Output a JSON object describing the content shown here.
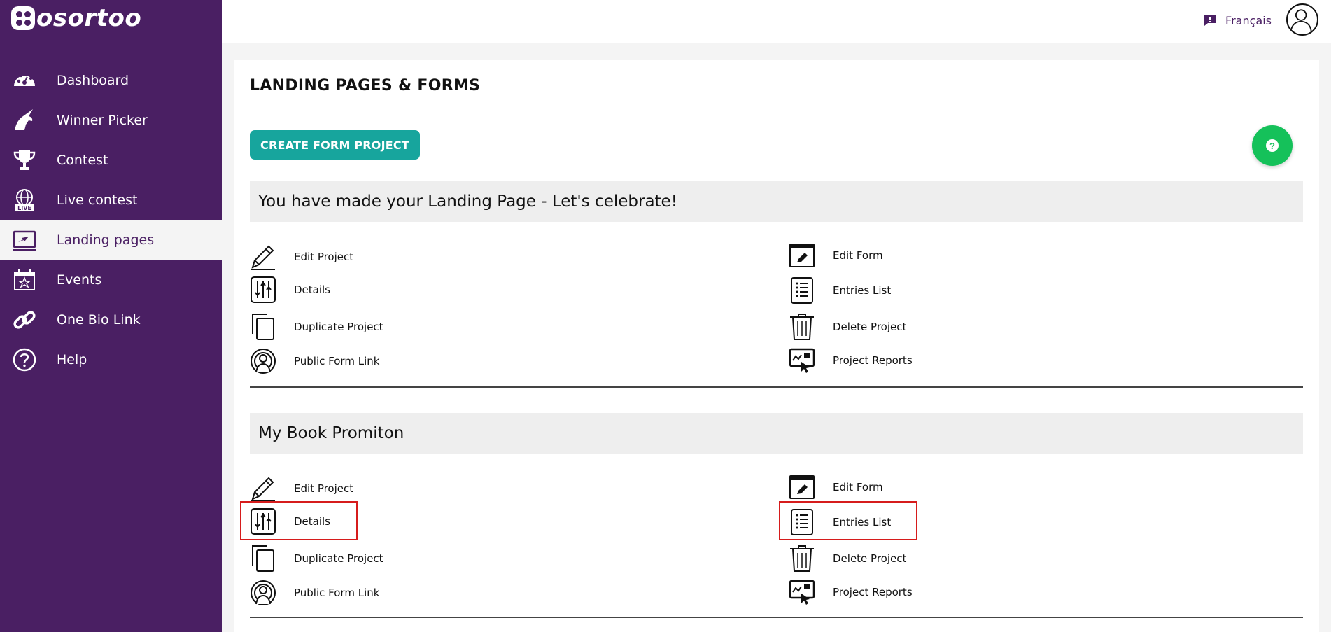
{
  "brand": {
    "name": "osortoo"
  },
  "sidebar": {
    "items": [
      {
        "label": "Dashboard",
        "icon": "dashboard-gauge-icon"
      },
      {
        "label": "Winner Picker",
        "icon": "unicorn-icon"
      },
      {
        "label": "Contest",
        "icon": "trophy-icon"
      },
      {
        "label": "Live contest",
        "icon": "live-globe-icon"
      },
      {
        "label": "Landing pages",
        "icon": "landing-page-icon",
        "active": true
      },
      {
        "label": "Events",
        "icon": "calendar-star-icon"
      },
      {
        "label": "One Bio Link",
        "icon": "link-icon"
      },
      {
        "label": "Help",
        "icon": "question-circle-icon"
      }
    ]
  },
  "header": {
    "language": "Français"
  },
  "main": {
    "title": "LANDING PAGES & FORMS",
    "create_button": "CREATE FORM PROJECT",
    "help_button": "?"
  },
  "projects": [
    {
      "title": "You have made your Landing Page - Let's celebrate!",
      "left_actions": [
        "Edit Project",
        "Details",
        "Duplicate Project",
        "Public Form Link"
      ],
      "right_actions": [
        "Edit Form",
        "Entries List",
        "Delete Project",
        "Project Reports"
      ]
    },
    {
      "title": "My Book Promiton",
      "left_actions": [
        "Edit Project",
        "Details",
        "Duplicate Project",
        "Public Form Link"
      ],
      "right_actions": [
        "Edit Form",
        "Entries List",
        "Delete Project",
        "Project Reports"
      ]
    }
  ],
  "colors": {
    "sidebar": "#4a1f63",
    "accent": "#17a59d",
    "help": "#15c15a",
    "highlight": "#d61c1c"
  }
}
